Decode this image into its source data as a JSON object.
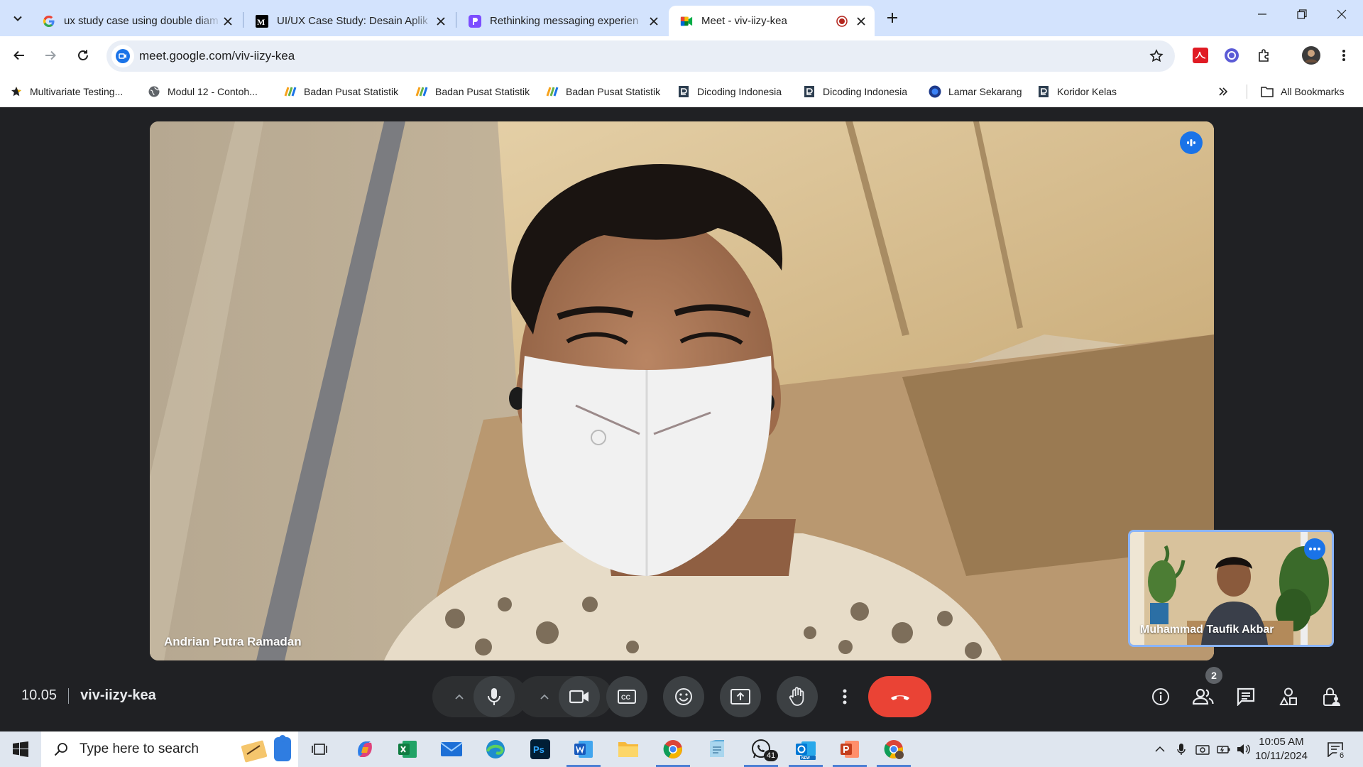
{
  "browser": {
    "tabs": [
      {
        "title": "ux study case using double diam",
        "favicon": "google-g-icon"
      },
      {
        "title": "UI/UX Case Study: Desain Aplik",
        "favicon": "medium-icon"
      },
      {
        "title": "Rethinking messaging experien",
        "favicon": "purple-doc-icon"
      },
      {
        "title": "Meet - viv-iizy-kea",
        "favicon": "google-meet-icon",
        "active": true,
        "recording": true
      }
    ],
    "url": "meet.google.com/viv-iizy-kea",
    "bookmarks": [
      {
        "label": "Multivariate Testing...",
        "icon": "star-bookmark-icon"
      },
      {
        "label": "Modul 12 - Contoh...",
        "icon": "globe-icon"
      },
      {
        "label": "Badan Pusat Statistik",
        "icon": "bps-icon"
      },
      {
        "label": "Badan Pusat Statistik",
        "icon": "bps-icon"
      },
      {
        "label": "Badan Pusat Statistik",
        "icon": "bps-icon"
      },
      {
        "label": "Dicoding Indonesia",
        "icon": "dicoding-icon"
      },
      {
        "label": "Dicoding Indonesia",
        "icon": "dicoding-icon"
      },
      {
        "label": "Lamar Sekarang",
        "icon": "lamar-icon"
      },
      {
        "label": "Koridor Kelas",
        "icon": "dicoding-icon"
      }
    ],
    "all_bookmarks_label": "All Bookmarks"
  },
  "meet": {
    "main_participant": "Andrian Putra Ramadan",
    "self_participant": "Muhammad Taufik Akbar",
    "time": "10.05",
    "meeting_code": "viv-iizy-kea",
    "participant_count": "2",
    "leave_color": "#ea4335",
    "accent_color": "#1a73e8"
  },
  "taskbar": {
    "search_placeholder": "Type here to search",
    "whatsapp_count": "41",
    "clock_time": "10:05 AM",
    "clock_date": "10/11/2024",
    "notification_count": "6"
  }
}
